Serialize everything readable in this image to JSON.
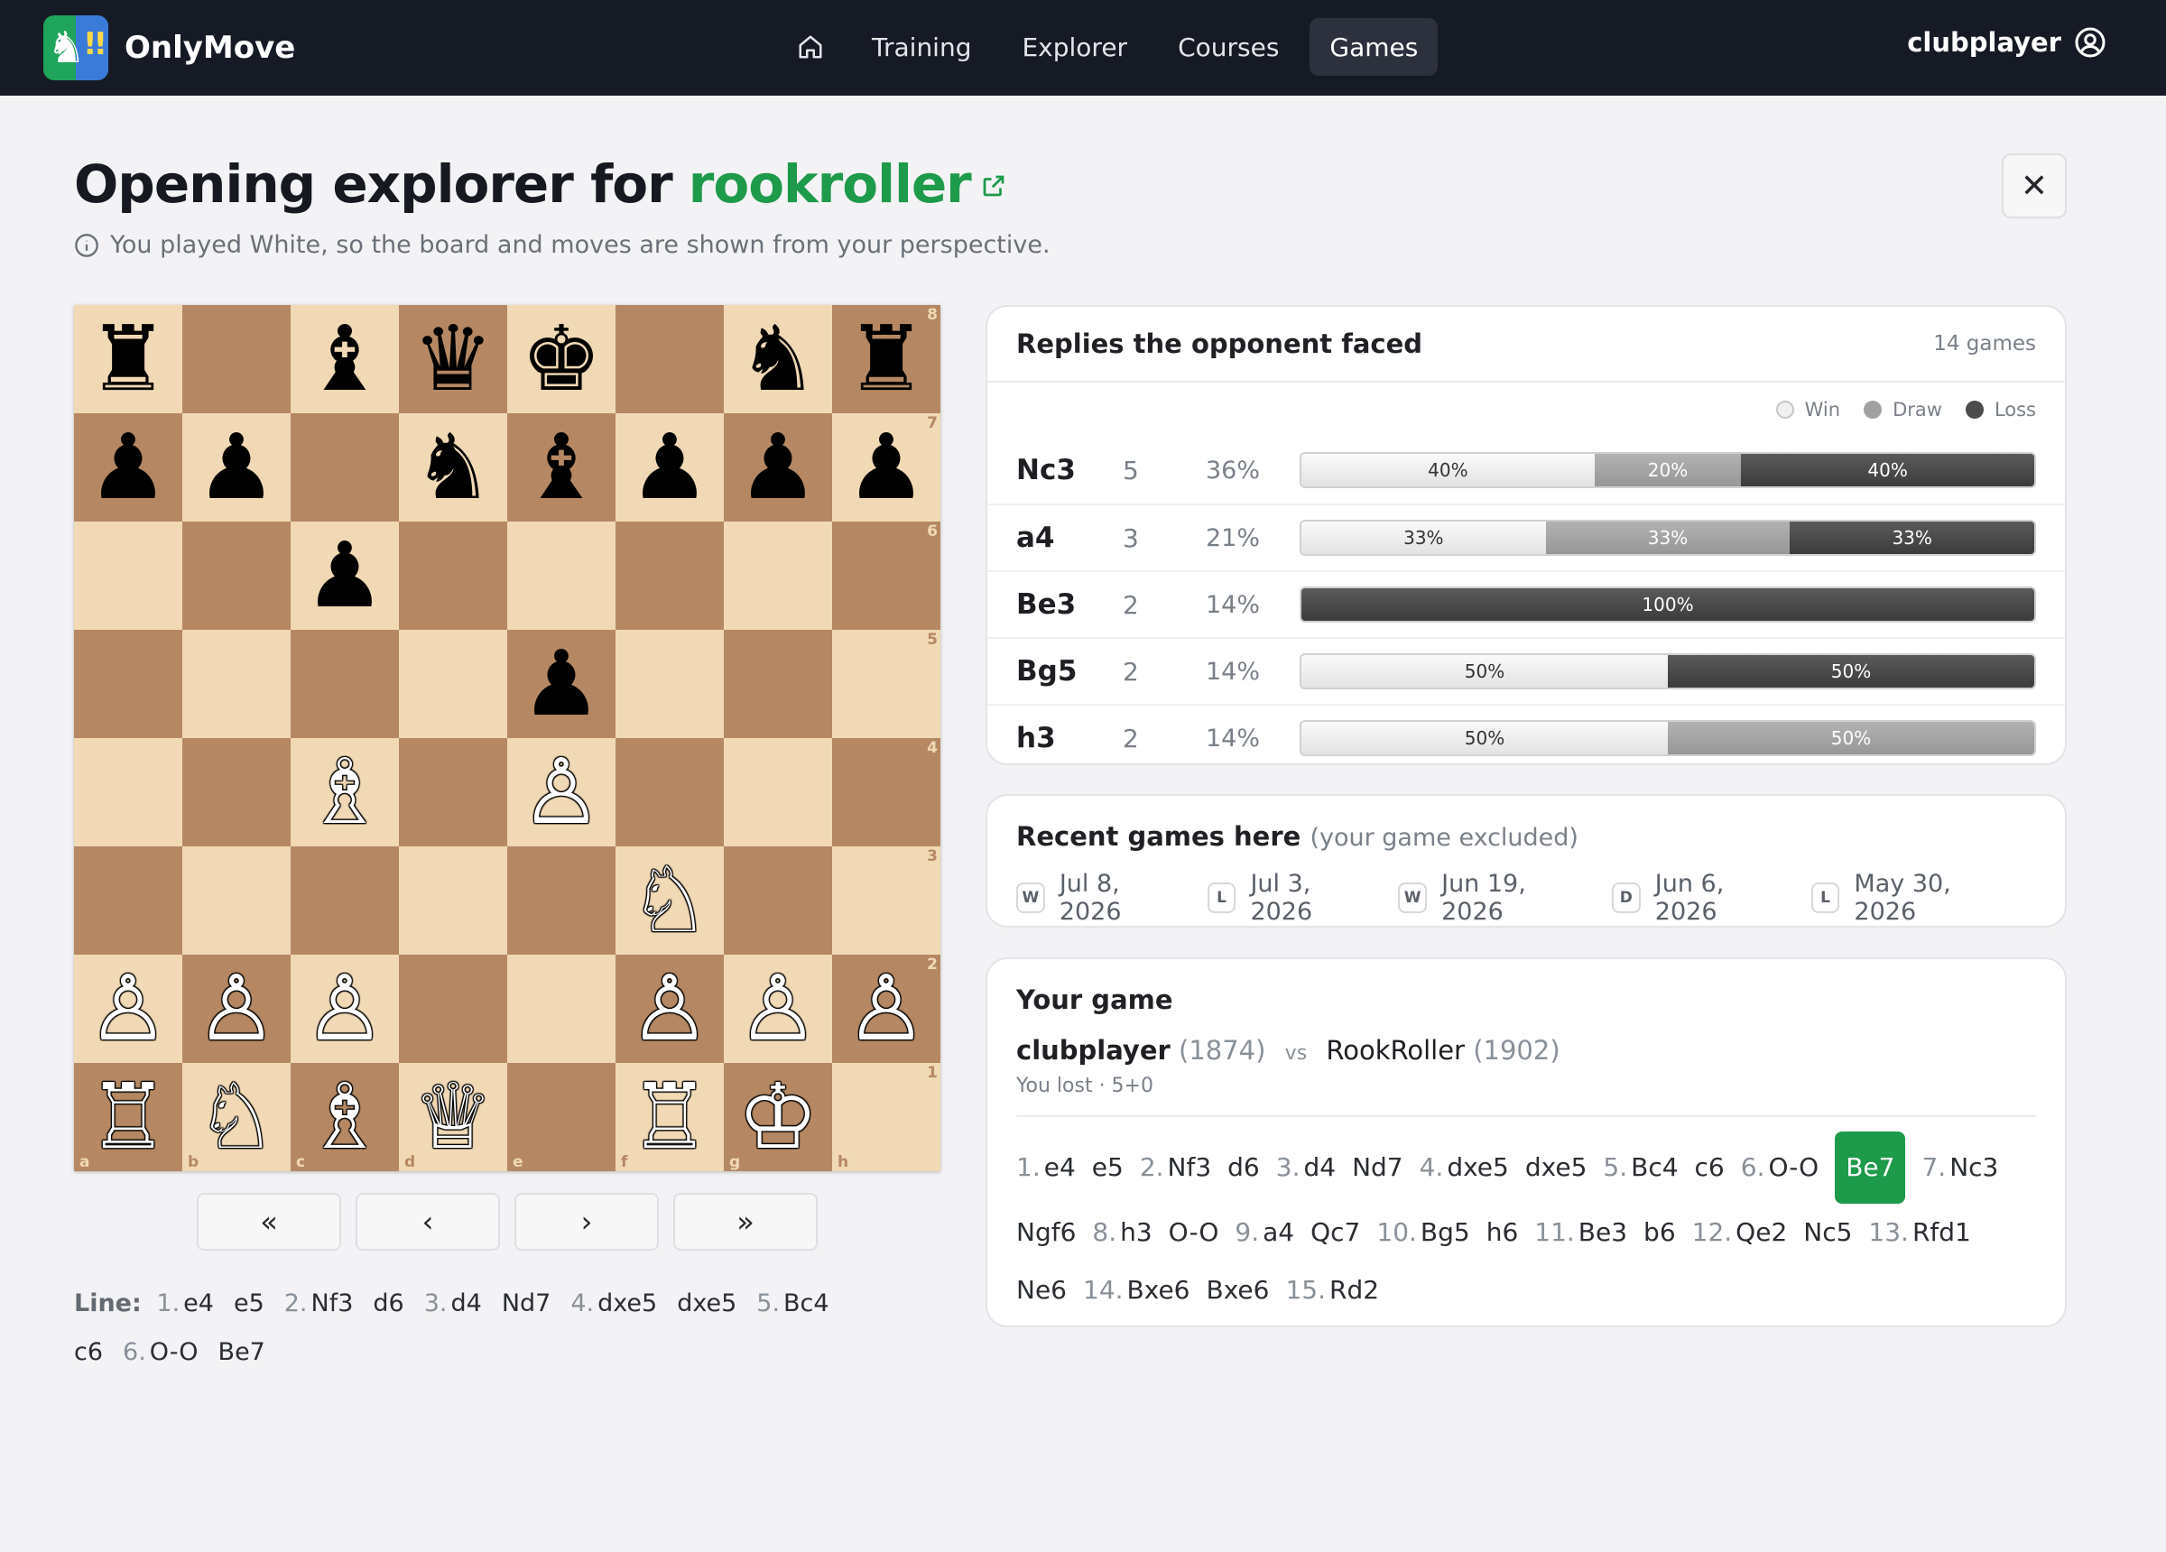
{
  "nav": {
    "brand": "OnlyMove",
    "links": [
      {
        "label": "Training",
        "active": false
      },
      {
        "label": "Explorer",
        "active": false
      },
      {
        "label": "Courses",
        "active": false
      },
      {
        "label": "Games",
        "active": true
      }
    ],
    "user": "clubplayer"
  },
  "header": {
    "title_prefix": "Opening explorer for",
    "opponent": "rookroller",
    "subtitle": "You played White, so the board and moves are shown from your perspective."
  },
  "board": {
    "orientation": "white",
    "ranks": [
      [
        "♜",
        "",
        "♝",
        "♛",
        "♚",
        "",
        "♞",
        "♜"
      ],
      [
        "♟",
        "♟",
        "",
        "♞",
        "♝",
        "♟",
        "♟",
        "♟"
      ],
      [
        "",
        "",
        "♟",
        "",
        "",
        "",
        "",
        ""
      ],
      [
        "",
        "",
        "",
        "",
        "♟",
        "",
        "",
        ""
      ],
      [
        "",
        "",
        "♗",
        "",
        "♙",
        "",
        "",
        ""
      ],
      [
        "",
        "",
        "",
        "",
        "",
        "♘",
        "",
        ""
      ],
      [
        "♙",
        "♙",
        "♙",
        "",
        "",
        "♙",
        "♙",
        "♙"
      ],
      [
        "♖",
        "♘",
        "♗",
        "♕",
        "",
        "♖",
        "♔",
        ""
      ]
    ],
    "rank_labels": [
      "8",
      "7",
      "6",
      "5",
      "4",
      "3",
      "2",
      "1"
    ],
    "file_labels": [
      "a",
      "b",
      "c",
      "d",
      "e",
      "f",
      "g",
      "h"
    ],
    "light_color": "#f1d9b5",
    "dark_color": "#b58863"
  },
  "controls": {
    "first": "«",
    "prev": "‹",
    "next": "›",
    "last": "»"
  },
  "line": {
    "label": "Line:",
    "moves": [
      {
        "num": "1.",
        "san": "e4"
      },
      {
        "san": "e5"
      },
      {
        "num": "2.",
        "san": "Nf3"
      },
      {
        "san": "d6"
      },
      {
        "num": "3.",
        "san": "d4"
      },
      {
        "san": "Nd7"
      },
      {
        "num": "4.",
        "san": "dxe5"
      },
      {
        "san": "dxe5"
      },
      {
        "num": "5.",
        "san": "Bc4"
      },
      {
        "san": "c6"
      },
      {
        "num": "6.",
        "san": "O-O"
      },
      {
        "san": "Be7"
      }
    ]
  },
  "replies": {
    "title": "Replies the opponent faced",
    "games": "14 games",
    "legend": {
      "win": "Win",
      "draw": "Draw",
      "loss": "Loss"
    },
    "rows": [
      {
        "move": "Nc3",
        "count": "5",
        "pct": "36%",
        "win": 40,
        "draw": 20,
        "loss": 40
      },
      {
        "move": "a4",
        "count": "3",
        "pct": "21%",
        "win": 33,
        "draw": 33,
        "loss": 33
      },
      {
        "move": "Be3",
        "count": "2",
        "pct": "14%",
        "win": 0,
        "draw": 0,
        "loss": 100
      },
      {
        "move": "Bg5",
        "count": "2",
        "pct": "14%",
        "win": 50,
        "draw": 0,
        "loss": 50
      },
      {
        "move": "h3",
        "count": "2",
        "pct": "14%",
        "win": 50,
        "draw": 50,
        "loss": 0
      }
    ],
    "colors": {
      "win": "#efefef",
      "draw": "#a3a3a3",
      "loss": "#4a4a4a"
    }
  },
  "recent": {
    "title": "Recent games here",
    "aside": "(your game excluded)",
    "games": [
      {
        "result": "W",
        "date": "Jul 8, 2026"
      },
      {
        "result": "L",
        "date": "Jul 3, 2026"
      },
      {
        "result": "W",
        "date": "Jun 19, 2026"
      },
      {
        "result": "D",
        "date": "Jun 6, 2026"
      },
      {
        "result": "L",
        "date": "May 30, 2026"
      }
    ]
  },
  "your_game": {
    "title": "Your game",
    "white": "clubplayer",
    "white_elo": "(1874)",
    "vs": "vs",
    "black": "RookRoller",
    "black_elo": "(1902)",
    "result": "You lost · 5+0",
    "highlight_color": "#1d9a4a",
    "moves": [
      {
        "num": "1.",
        "san": "e4"
      },
      {
        "san": "e5"
      },
      {
        "num": "2.",
        "san": "Nf3"
      },
      {
        "san": "d6"
      },
      {
        "num": "3.",
        "san": "d4"
      },
      {
        "san": "Nd7"
      },
      {
        "num": "4.",
        "san": "dxe5"
      },
      {
        "san": "dxe5"
      },
      {
        "num": "5.",
        "san": "Bc4"
      },
      {
        "san": "c6"
      },
      {
        "num": "6.",
        "san": "O-O"
      },
      {
        "san": "Be7",
        "current": true
      },
      {
        "num": "7.",
        "san": "Nc3"
      },
      {
        "san": "Ngf6"
      },
      {
        "num": "8.",
        "san": "h3"
      },
      {
        "san": "O-O"
      },
      {
        "num": "9.",
        "san": "a4"
      },
      {
        "san": "Qc7"
      },
      {
        "num": "10.",
        "san": "Bg5"
      },
      {
        "san": "h6"
      },
      {
        "num": "11.",
        "san": "Be3"
      },
      {
        "san": "b6"
      },
      {
        "num": "12.",
        "san": "Qe2"
      },
      {
        "san": "Nc5"
      },
      {
        "num": "13.",
        "san": "Rfd1"
      },
      {
        "san": "Ne6"
      },
      {
        "num": "14.",
        "san": "Bxe6"
      },
      {
        "san": "Bxe6"
      },
      {
        "num": "15.",
        "san": "Rd2"
      }
    ]
  }
}
